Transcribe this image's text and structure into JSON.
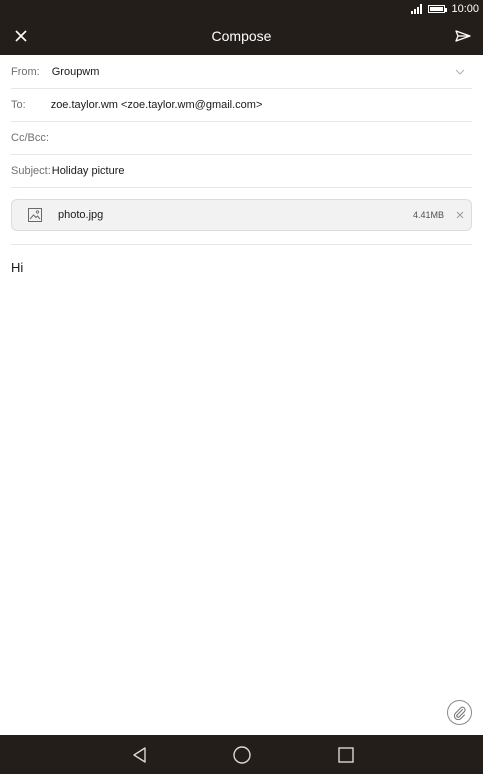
{
  "status_bar": {
    "time": "10:00"
  },
  "app_bar": {
    "title": "Compose"
  },
  "form": {
    "from_label": "From:",
    "from_value": "Groupwm",
    "to_label": "To:",
    "to_value": "zoe.taylor.wm <zoe.taylor.wm@gmail.com>",
    "cc_label": "Cc/Bcc:",
    "cc_value": "",
    "subject_label": "Subject:",
    "subject_value": "Holiday picture"
  },
  "attachment": {
    "name": "photo.jpg",
    "size": "4.41MB"
  },
  "body": {
    "text": "Hi"
  },
  "colors": {
    "bar_background": "#241e1a",
    "label": "#707070",
    "text": "#1a1a1a",
    "divider": "#e6e6e6"
  },
  "icons": {
    "close": "close-icon",
    "send": "send-icon",
    "dropdown": "chevron-down-icon",
    "attachment_file": "image-icon",
    "remove": "remove-icon",
    "attach": "paperclip-icon",
    "nav_back": "back-icon",
    "nav_home": "home-icon",
    "nav_recent": "recent-apps-icon"
  }
}
